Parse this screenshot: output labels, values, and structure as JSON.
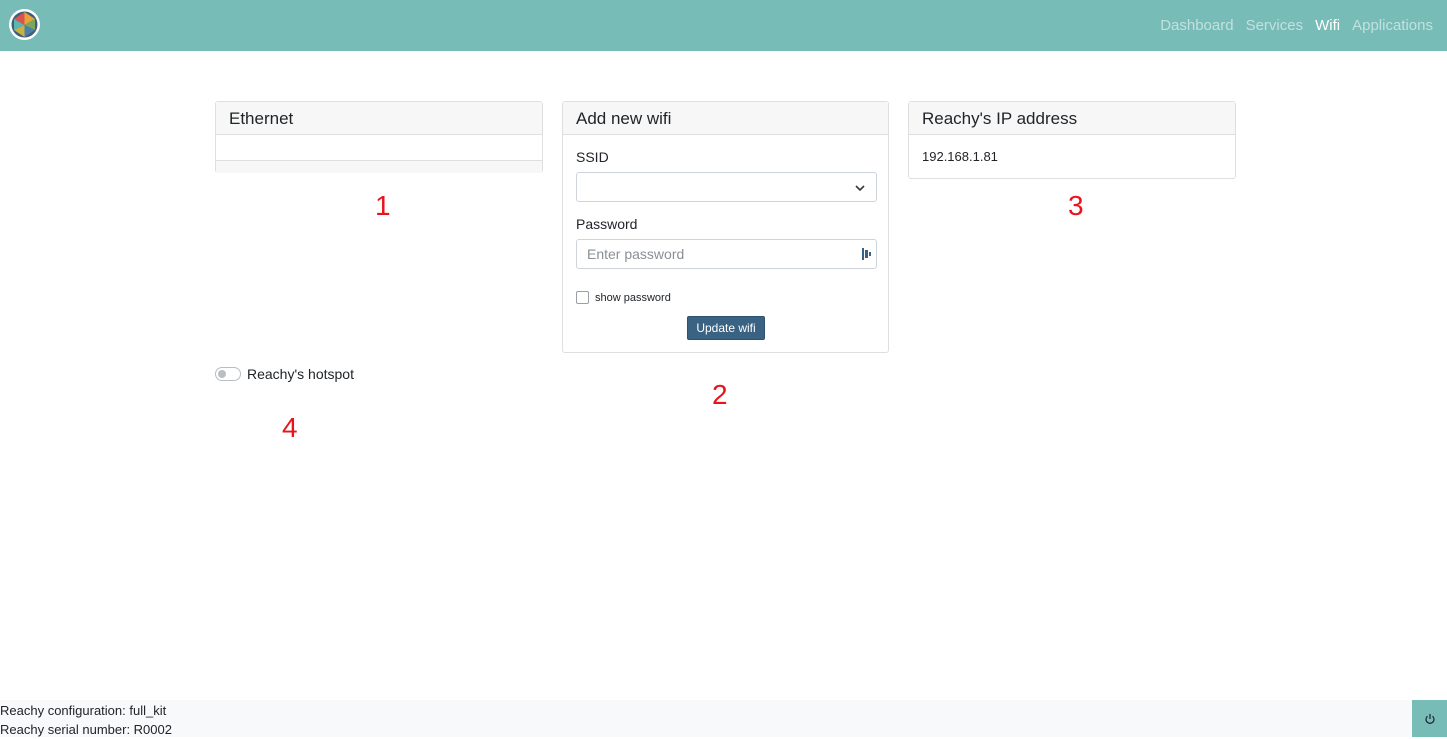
{
  "nav": {
    "links": [
      "Dashboard",
      "Services",
      "Wifi",
      "Applications"
    ],
    "active_index": 2
  },
  "ethernet_card": {
    "title": "Ethernet"
  },
  "wifi_card": {
    "title": "Add new wifi",
    "ssid_label": "SSID",
    "ssid_value": "",
    "password_label": "Password",
    "password_placeholder": "Enter password",
    "show_password_label": "show password",
    "show_password_checked": false,
    "update_button": "Update wifi"
  },
  "ip_card": {
    "title": "Reachy's IP address",
    "ip": "192.168.1.81"
  },
  "hotspot": {
    "label": "Reachy's hotspot",
    "enabled": false
  },
  "annotations": [
    "1",
    "2",
    "3",
    "4"
  ],
  "footer": {
    "configuration": "Reachy configuration: full_kit",
    "serial": "Reachy serial number: R0002"
  },
  "colors": {
    "navbar": "#78bcb8",
    "button": "#3a6283",
    "annotation": "#e8131b"
  },
  "icons": {
    "logo": "reachy-logo-icon",
    "ssid_dropdown": "chevron-down-icon",
    "password_manager": "password-manager-icon",
    "power": "power-icon"
  }
}
